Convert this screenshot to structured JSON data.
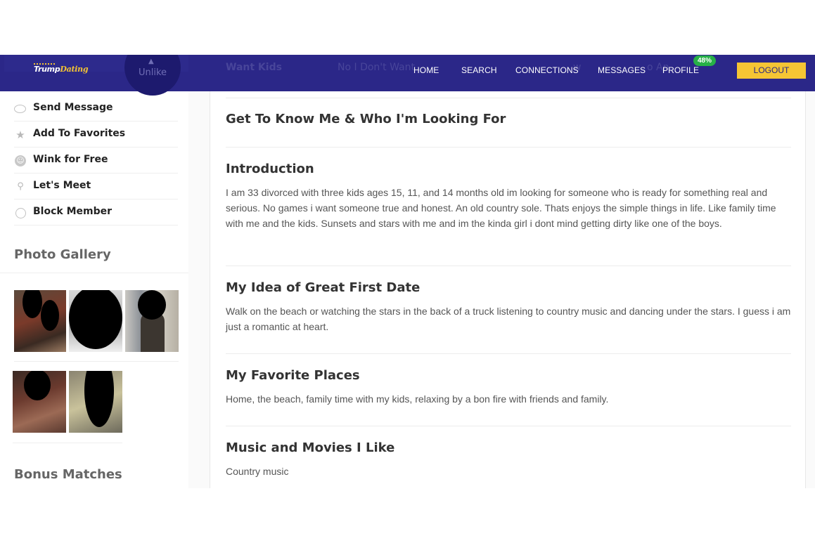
{
  "header": {
    "logo": {
      "part1": "Trump",
      "part2": "Dating"
    },
    "nav": [
      {
        "label": "HOME"
      },
      {
        "label": "SEARCH"
      },
      {
        "label": "CONNECTIONS"
      },
      {
        "label": "MESSAGES"
      },
      {
        "label": "PROFILE"
      }
    ],
    "profile_badge": "48%",
    "logout_label": "LOGOUT",
    "ghost": {
      "want_kids": "Want Kids",
      "no_dont": "No I Don't Want",
      "w": "w",
      "an": "o An",
      "unlike": "Unlike"
    }
  },
  "sidebar": {
    "actions": [
      {
        "label": "Send Message",
        "icon": "speech-bubble-icon"
      },
      {
        "label": "Add To Favorites",
        "icon": "star-icon"
      },
      {
        "label": "Wink for Free",
        "icon": "wink-face-icon"
      },
      {
        "label": "Let's Meet",
        "icon": "people-icon"
      },
      {
        "label": "Block Member",
        "icon": "block-icon"
      }
    ],
    "photo_gallery_title": "Photo Gallery",
    "bonus_matches_title": "Bonus Matches"
  },
  "main": {
    "section_title": "Get To Know Me & Who I'm Looking For",
    "sections": [
      {
        "heading": "Introduction",
        "body": "I am 33 divorced with three kids ages 15, 11, and 14 months old im looking for someone who is ready for something real and serious. No games i want someone true and honest. An old country sole. Thats enjoys the simple things in life. Like family time with me and the kids. Sunsets and stars with me and im the kinda girl i dont mind getting dirty like one of the boys."
      },
      {
        "heading": "My Idea of Great First Date",
        "body": "Walk on the beach or watching the stars in the back of a truck listening to country music and dancing under the stars. I guess i am just a romantic at heart."
      },
      {
        "heading": "My Favorite Places",
        "body": "Home, the beach, family time with my kids, relaxing by a bon fire with friends and family."
      },
      {
        "heading": "Music and Movies I Like",
        "body": "Country music"
      }
    ]
  },
  "colors": {
    "nav_bg": "#242084",
    "logout_bg": "#f5c534",
    "badge_bg": "#27b047"
  }
}
